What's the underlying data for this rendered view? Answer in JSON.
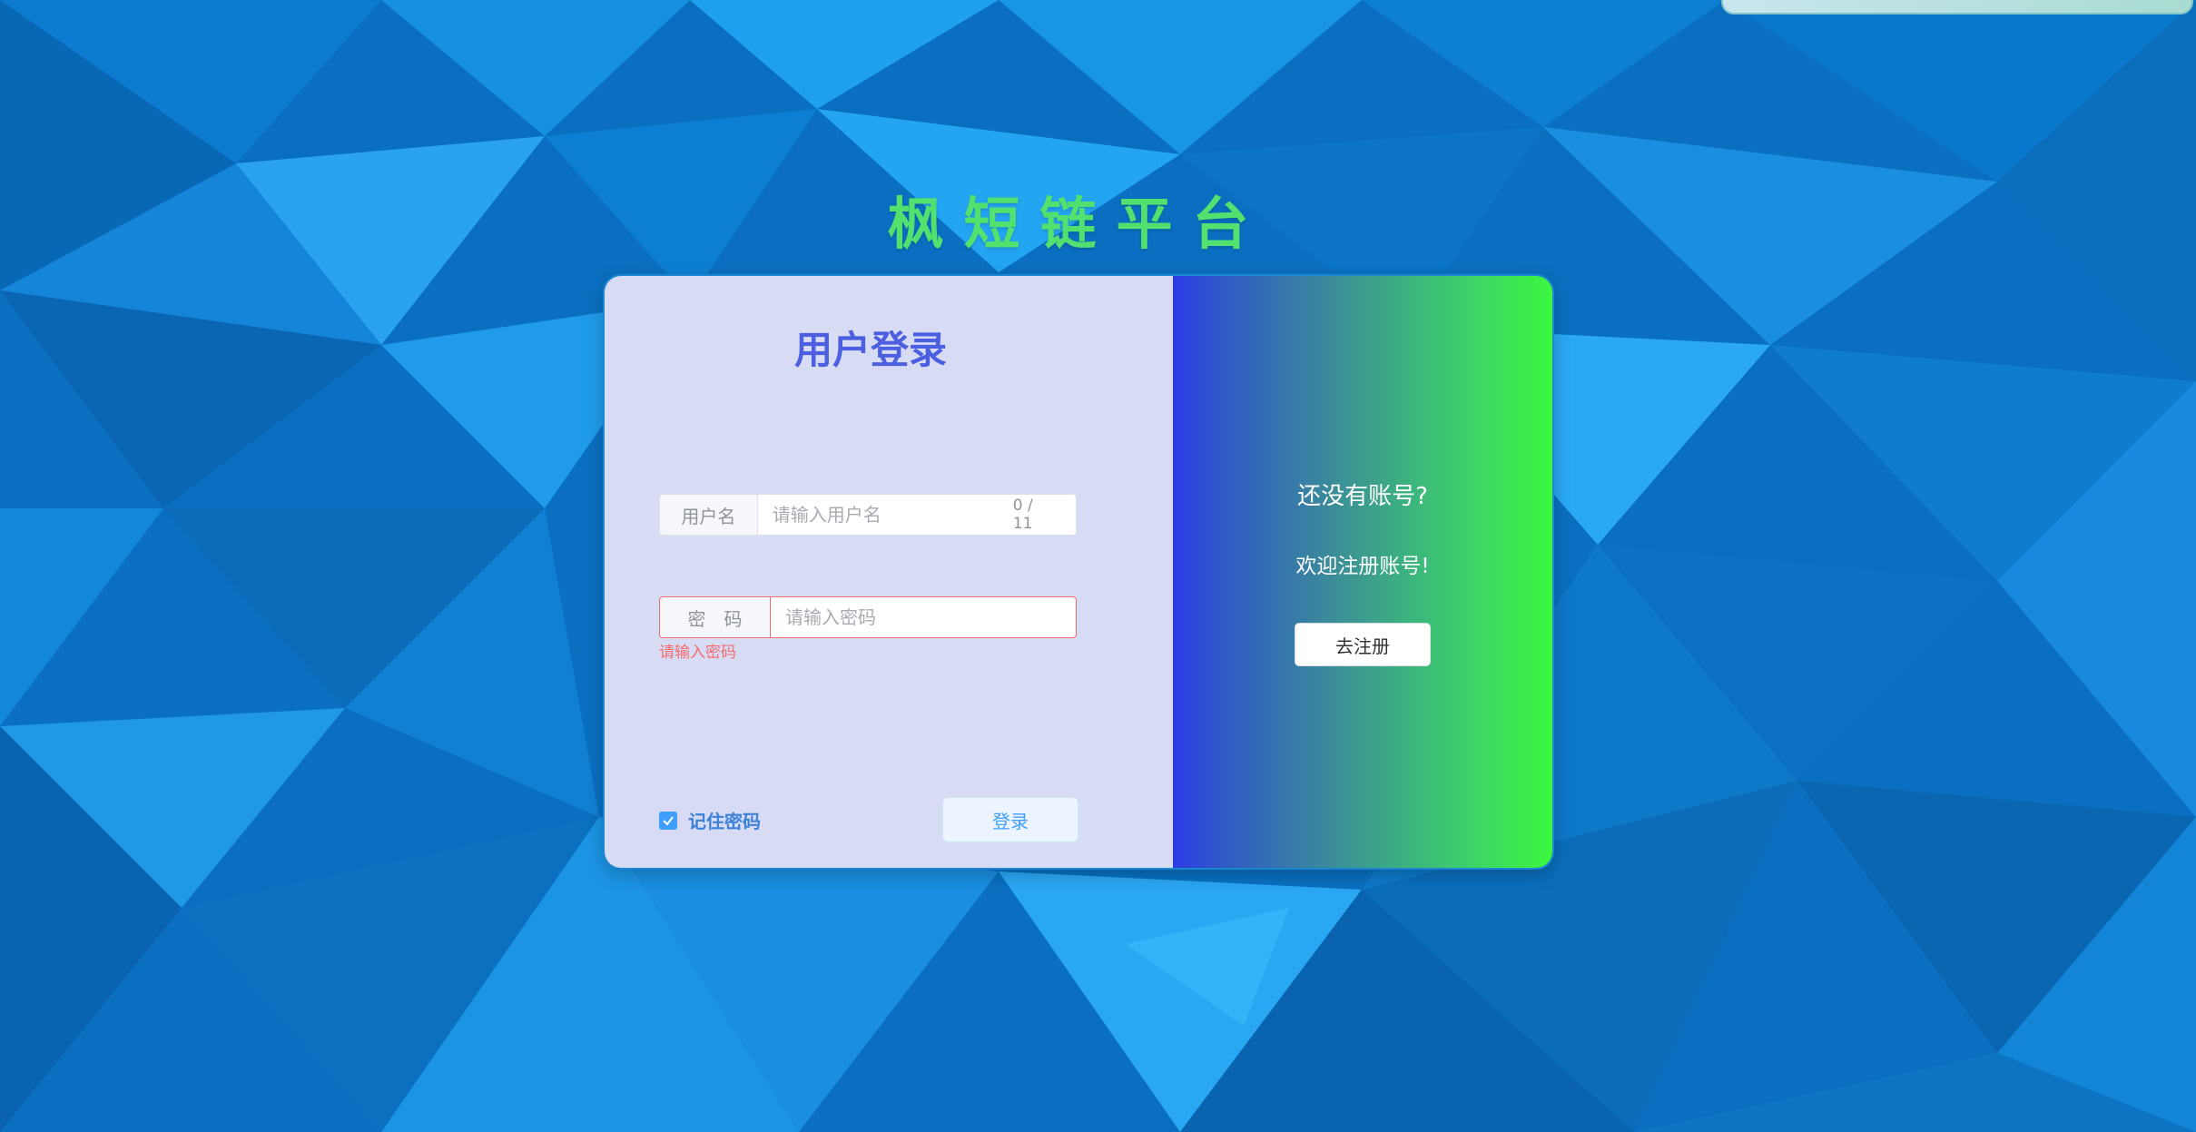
{
  "page": {
    "platform_title": "枫短链平台",
    "accent_color": "#52e06e"
  },
  "login": {
    "title": "用户登录",
    "username": {
      "label": "用户名",
      "placeholder": "请输入用户名",
      "value": "",
      "counter": "0 / 11"
    },
    "password": {
      "label": "密　码",
      "placeholder": "请输入密码",
      "value": "",
      "error": "请输入密码"
    },
    "remember": {
      "label": "记住密码",
      "checked": true,
      "icon": "check-icon"
    },
    "submit_label": "登录"
  },
  "register": {
    "question": "还没有账号?",
    "welcome": "欢迎注册账号!",
    "button_label": "去注册"
  }
}
